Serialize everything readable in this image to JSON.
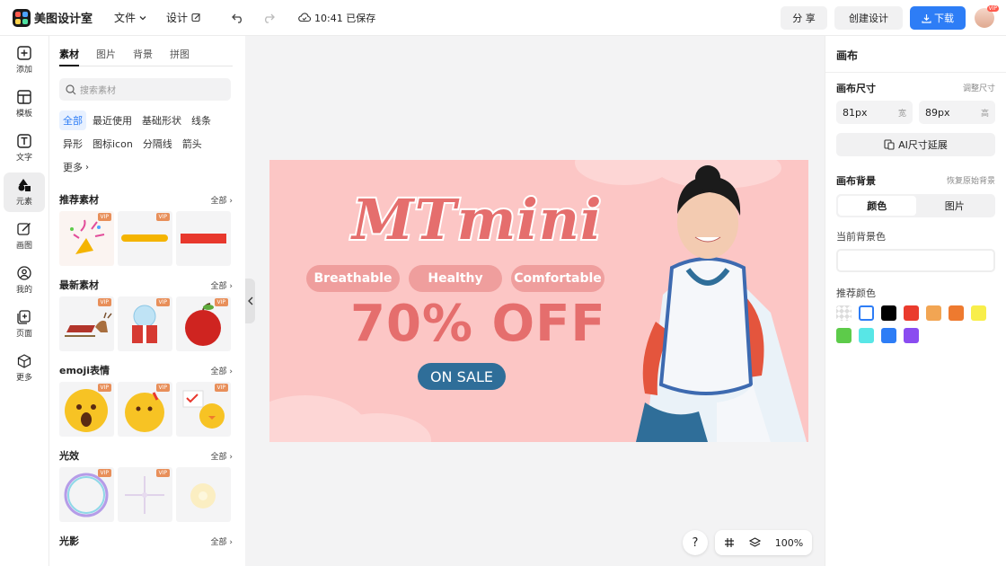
{
  "app": {
    "name": "美图设计室"
  },
  "topbar": {
    "file_label": "文件",
    "design_label": "设计",
    "saved_text": "10:41 已保存",
    "share_label": "分 享",
    "create_label": "创建设计",
    "download_label": "下载",
    "avatar_badge": "VIP"
  },
  "rail": [
    {
      "label": "添加",
      "icon": "plus-square-icon"
    },
    {
      "label": "模板",
      "icon": "template-icon"
    },
    {
      "label": "文字",
      "icon": "text-icon"
    },
    {
      "label": "元素",
      "icon": "elements-icon"
    },
    {
      "label": "画图",
      "icon": "draw-icon"
    },
    {
      "label": "我的",
      "icon": "user-icon"
    },
    {
      "label": "页面",
      "icon": "page-icon"
    },
    {
      "label": "更多",
      "icon": "cube-icon"
    }
  ],
  "panel": {
    "tabs": [
      "素材",
      "图片",
      "背景",
      "拼图"
    ],
    "search_placeholder": "搜索素材",
    "chips": [
      "全部",
      "最近使用",
      "基础形状",
      "线条",
      "异形",
      "图标icon",
      "分隔线",
      "箭头",
      "更多"
    ],
    "all_label": "全部",
    "vip_label": "VIP",
    "sections": [
      {
        "title": "推荐素材"
      },
      {
        "title": "最新素材"
      },
      {
        "title": "emoji表情"
      },
      {
        "title": "光效"
      },
      {
        "title": "光影"
      }
    ]
  },
  "canvas": {
    "title": "MTmini",
    "tags": [
      "Breathable",
      "Healthy",
      "Comfortable"
    ],
    "discount": "70% OFF",
    "sale": "ON SALE",
    "background": "#fcc6c5"
  },
  "right": {
    "title": "画布",
    "size_label": "画布尺寸",
    "adjust_label": "调整尺寸",
    "width_value": "81px",
    "width_unit": "宽",
    "height_value": "89px",
    "height_unit": "高",
    "ai_label": "AI尺寸延展",
    "bg_label": "画布背景",
    "restore_label": "恢复原始背景",
    "seg_color": "颜色",
    "seg_image": "图片",
    "current_bg_label": "当前背景色",
    "recommend_label": "推荐颜色",
    "swatches": [
      "transparent",
      "#ffffff",
      "#000000",
      "#ea3b2d",
      "#f2a553",
      "#ee7a2f",
      "#f8ee4a",
      "#5dcb4a",
      "#58e6e6",
      "#2d7df6",
      "#8a4cf0"
    ]
  },
  "bottom": {
    "help": "?",
    "zoom": "100%"
  },
  "colors": {
    "accent": "#2d7df6",
    "brand_pink": "#e56e6d",
    "sale_blue": "#2f6e99"
  }
}
